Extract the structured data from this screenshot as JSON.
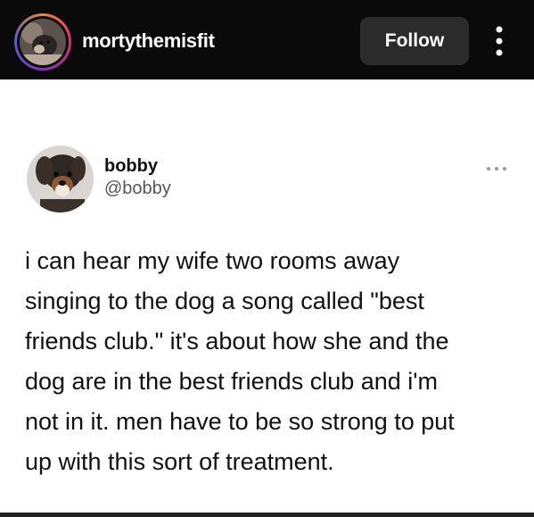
{
  "header": {
    "account_name": "mortythemisfit",
    "follow_label": "Follow",
    "more_icon": "more-vertical-icon",
    "background": "#0a0a0a",
    "follow_background": "#2b2b2b"
  },
  "tweet": {
    "display_name": "bobby",
    "handle": "@bobby",
    "more_icon": "more-horizontal-icon",
    "lines": [
      "i can hear my wife two rooms away",
      "singing to the dog a song called \"best",
      "friends club.\" it's about how she and the",
      "dog are in the best friends club and i'm",
      "not in it. men have to be so strong to put",
      "up with this sort of treatment."
    ]
  }
}
